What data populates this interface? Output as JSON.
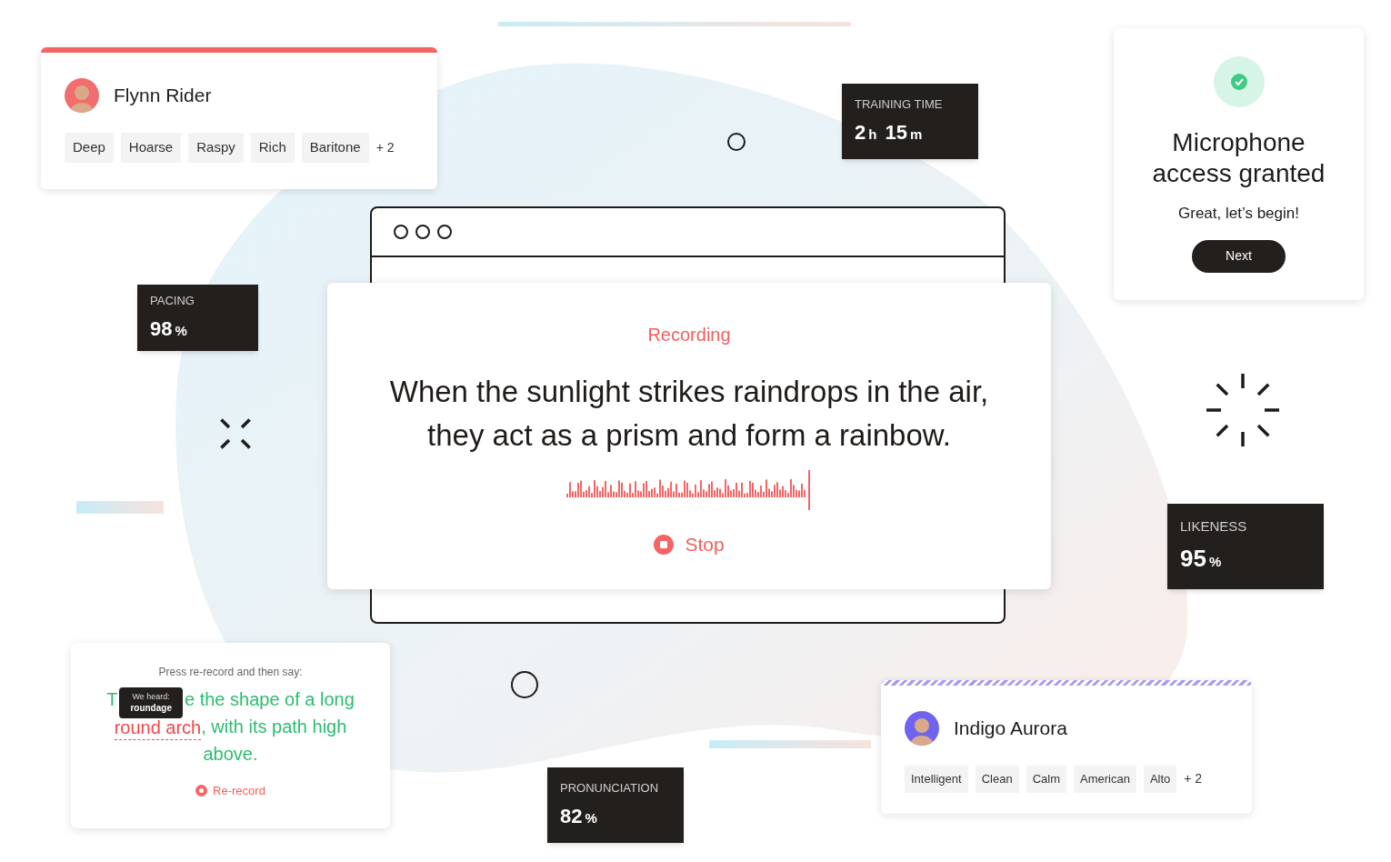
{
  "voice_cards": [
    {
      "name": "Flynn Rider",
      "kind": "solid",
      "tags": [
        "Deep",
        "Hoarse",
        "Raspy",
        "Rich",
        "Baritone"
      ],
      "more": "+ 2"
    },
    {
      "name": "Indigo Aurora",
      "kind": "striped",
      "tags": [
        "Intelligent",
        "Clean",
        "Calm",
        "American",
        "Alto"
      ],
      "more": "+ 2"
    }
  ],
  "stats": [
    {
      "label": "TRAINING TIME",
      "parts": [
        {
          "kind": "number",
          "text": "2"
        },
        {
          "kind": "unit",
          "text": "h"
        },
        {
          "kind": "number",
          "text": "15"
        },
        {
          "kind": "unit",
          "text": "m"
        }
      ]
    },
    {
      "label": "PACING",
      "parts": [
        {
          "kind": "number",
          "text": "98"
        },
        {
          "kind": "unit",
          "text": "%"
        }
      ]
    },
    {
      "label": "LIKENESS",
      "parts": [
        {
          "kind": "number",
          "text": "95"
        },
        {
          "kind": "unit",
          "text": "%"
        }
      ]
    },
    {
      "label": "PRONUNCIATION",
      "parts": [
        {
          "kind": "number",
          "text": "82"
        },
        {
          "kind": "unit",
          "text": "%"
        }
      ]
    }
  ],
  "permission_card": {
    "title": "Microphone access granted",
    "message": "Great, let’s begin!",
    "button": "Next"
  },
  "recording_card": {
    "status": "Recording",
    "prompt": "When the sunlight strikes raindrops in the air, they act as a prism and form a rainbow.",
    "button": "Stop"
  },
  "rerecord_card": {
    "instruction": "Press re-record and then say:",
    "tooltip": {
      "label": "We heard:",
      "value": "roundage"
    },
    "lines": [
      [
        {
          "text": "T",
          "correct": true
        },
        {
          "kind": "tooltip"
        },
        {
          "text": "e the shape of a long",
          "correct": true
        }
      ],
      [
        {
          "text": "round arch",
          "correct": false
        },
        {
          "text": ", with its path high",
          "correct": true
        }
      ],
      [
        {
          "text": "above.",
          "correct": true
        }
      ]
    ],
    "button": "Re-record"
  }
}
